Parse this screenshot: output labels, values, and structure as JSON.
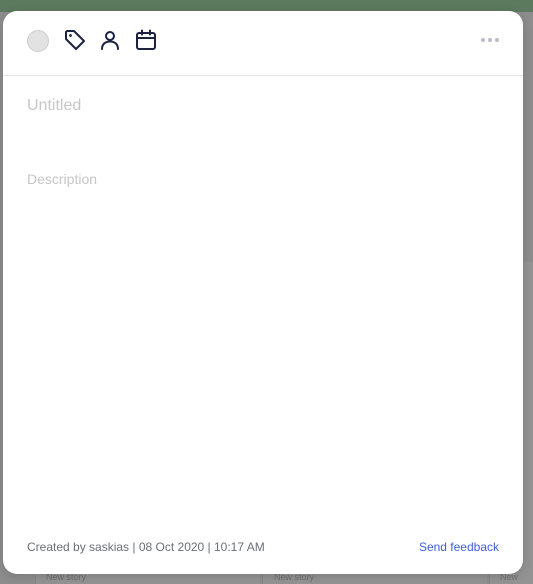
{
  "modal": {
    "title_placeholder": "Untitled",
    "description_placeholder": "Description",
    "header_icons": [
      "status-circle",
      "tag-icon",
      "user-icon",
      "calendar-icon",
      "more-icon"
    ],
    "footer": {
      "created_text": "Created by saskias | 08 Oct 2020 | 10:17 AM",
      "feedback_label": "Send feedback"
    },
    "colors": {
      "accent_link": "#3d5fd6",
      "icon_dark": "#1c2340",
      "placeholder": "#c6c6c6"
    }
  },
  "background": {
    "new_story_label": "New story"
  }
}
